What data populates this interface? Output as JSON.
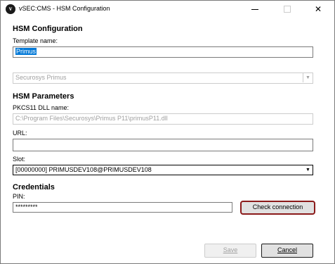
{
  "window": {
    "title": "vSEC:CMS - HSM Configuration",
    "app_icon_glyph": "v",
    "minimize_glyph": "—",
    "maximize_glyph": "☐",
    "close_glyph": "✕"
  },
  "hsm_config": {
    "heading": "HSM Configuration",
    "template_label": "Template name:",
    "template_value": "Primus",
    "hsm_type_value": "Securosys Primus"
  },
  "hsm_params": {
    "heading": "HSM Parameters",
    "pkcs11_label": "PKCS11 DLL name:",
    "pkcs11_value": "C:\\Program Files\\Securosys\\Primus P11\\primusP11.dll",
    "url_label": "URL:",
    "url_value": "",
    "slot_label": "Slot:",
    "slot_value": "[00000000] PRIMUSDEV108@PRIMUSDEV108"
  },
  "credentials": {
    "heading": "Credentials",
    "pin_label": "PIN:",
    "pin_value": "*********",
    "check_connection_label": "Check connection"
  },
  "buttons": {
    "save_label": "Save",
    "cancel_label": "Cancel"
  },
  "icons": {
    "dropdown": "chevron-down-icon",
    "app": "vsec-app-icon"
  },
  "colors": {
    "accent_border": "#8b1a1a",
    "selection": "#0078d7"
  }
}
